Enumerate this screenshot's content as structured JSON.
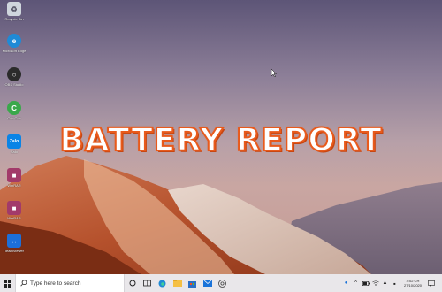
{
  "desktop": {
    "icons": [
      {
        "label": "Recycle Bin",
        "icon": "recycle-bin-icon",
        "color": "#cfd6dd"
      },
      {
        "label": "Microsoft Edge",
        "icon": "edge-icon",
        "color": "#1f8ad6"
      },
      {
        "label": "OBS Studio",
        "icon": "obs-icon",
        "color": "#2b2b2b"
      },
      {
        "label": "Cốc Cốc",
        "icon": "coccoc-icon",
        "color": "#3aa84b"
      },
      {
        "label": "Zalo",
        "icon": "zalo-icon",
        "color": "#0a84e6"
      },
      {
        "label": "WinRAR",
        "icon": "winrar-icon",
        "color": "#a23a6a"
      },
      {
        "label": "WinRAR",
        "icon": "winrar-icon",
        "color": "#a23a6a"
      },
      {
        "label": "TeamViewer",
        "icon": "teamviewer-icon",
        "color": "#1d6fd8"
      }
    ]
  },
  "overlay": {
    "title": "BATTERY REPORT"
  },
  "taskbar": {
    "search_placeholder": "Type here to search",
    "apps": [
      "task-view-icon",
      "edge-icon",
      "file-explorer-icon",
      "store-icon",
      "mail-icon",
      "chrome-icon"
    ],
    "clock_time": "4:02 CH",
    "clock_date": "27/10/2020"
  },
  "colors": {
    "title_stroke": "#e85a1c",
    "taskbar_bg": "#e9e7ea"
  }
}
